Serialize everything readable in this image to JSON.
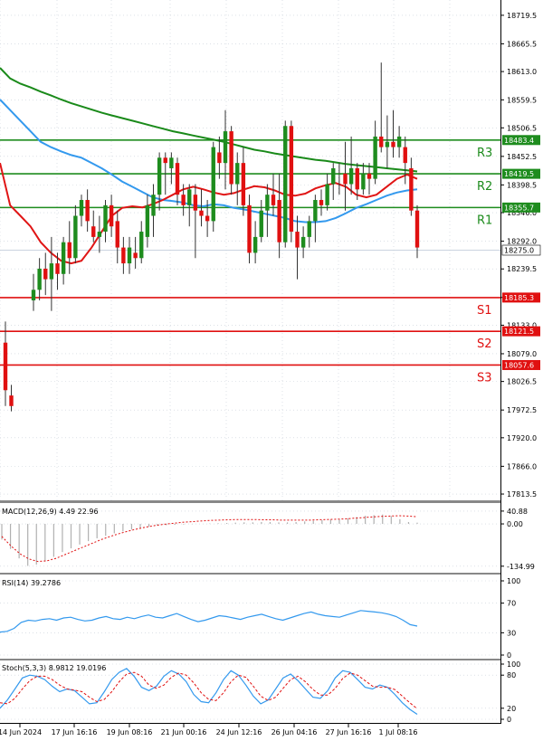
{
  "chart_data": {
    "type": "candlestick",
    "main": {
      "price_ticks": [
        "18719.5",
        "18665.5",
        "18613.0",
        "18559.5",
        "18506.5",
        "18452.5",
        "18398.5",
        "18346.0",
        "18292.0",
        "18239.5",
        "18185.5",
        "18133.0",
        "18079.0",
        "18026.5",
        "17972.5",
        "17920.0",
        "17866.0",
        "17813.5"
      ],
      "ylim": [
        17805,
        18745
      ],
      "last_price": "18275.0",
      "levels": [
        {
          "name": "R3",
          "label": "18483.4",
          "value": 18483.4,
          "color": "#1e8c1e"
        },
        {
          "name": "R2",
          "label": "18419.5",
          "value": 18419.5,
          "color": "#1e8c1e"
        },
        {
          "name": "R1",
          "label": "18355.7",
          "value": 18355.7,
          "color": "#1e8c1e"
        },
        {
          "name": "S1",
          "label": "18185.3",
          "value": 18185.3,
          "color": "#e01010"
        },
        {
          "name": "S2",
          "label": "18121.5",
          "value": 18121.5,
          "color": "#e01010"
        },
        {
          "name": "S3",
          "label": "18057.6",
          "value": 18057.6,
          "color": "#e01010"
        }
      ],
      "candles": [
        [
          18100,
          18140,
          17980,
          18010
        ],
        [
          18000,
          18020,
          17970,
          17980
        ],
        [
          18180,
          18230,
          18160,
          18200
        ],
        [
          18200,
          18260,
          18180,
          18240
        ],
        [
          18240,
          18270,
          18190,
          18220
        ],
        [
          18220,
          18300,
          18160,
          18250
        ],
        [
          18250,
          18270,
          18200,
          18230
        ],
        [
          18230,
          18300,
          18210,
          18290
        ],
        [
          18290,
          18330,
          18230,
          18260
        ],
        [
          18260,
          18360,
          18250,
          18340
        ],
        [
          18340,
          18380,
          18320,
          18370
        ],
        [
          18370,
          18390,
          18310,
          18330
        ],
        [
          18320,
          18350,
          18290,
          18300
        ],
        [
          18300,
          18340,
          18270,
          18310
        ],
        [
          18310,
          18370,
          18290,
          18360
        ],
        [
          18360,
          18380,
          18300,
          18320
        ],
        [
          18330,
          18350,
          18250,
          18280
        ],
        [
          18280,
          18300,
          18230,
          18250
        ],
        [
          18250,
          18300,
          18230,
          18280
        ],
        [
          18270,
          18300,
          18240,
          18260
        ],
        [
          18260,
          18330,
          18250,
          18310
        ],
        [
          18300,
          18380,
          18280,
          18360
        ],
        [
          18340,
          18400,
          18300,
          18380
        ],
        [
          18380,
          18460,
          18350,
          18450
        ],
        [
          18450,
          18460,
          18380,
          18440
        ],
        [
          18430,
          18460,
          18400,
          18450
        ],
        [
          18440,
          18450,
          18360,
          18380
        ],
        [
          18380,
          18400,
          18340,
          18360
        ],
        [
          18360,
          18400,
          18320,
          18390
        ],
        [
          18380,
          18400,
          18260,
          18350
        ],
        [
          18350,
          18390,
          18320,
          18340
        ],
        [
          18340,
          18370,
          18300,
          18330
        ],
        [
          18330,
          18480,
          18310,
          18470
        ],
        [
          18460,
          18490,
          18410,
          18440
        ],
        [
          18440,
          18540,
          18390,
          18500
        ],
        [
          18500,
          18510,
          18380,
          18400
        ],
        [
          18400,
          18460,
          18360,
          18440
        ],
        [
          18440,
          18470,
          18340,
          18360
        ],
        [
          18360,
          18380,
          18250,
          18270
        ],
        [
          18270,
          18330,
          18250,
          18300
        ],
        [
          18300,
          18370,
          18290,
          18350
        ],
        [
          18350,
          18400,
          18300,
          18380
        ],
        [
          18380,
          18420,
          18340,
          18360
        ],
        [
          18370,
          18420,
          18260,
          18290
        ],
        [
          18290,
          18520,
          18280,
          18510
        ],
        [
          18510,
          18520,
          18290,
          18310
        ],
        [
          18310,
          18340,
          18220,
          18280
        ],
        [
          18280,
          18320,
          18260,
          18300
        ],
        [
          18300,
          18340,
          18280,
          18330
        ],
        [
          18330,
          18380,
          18290,
          18370
        ],
        [
          18370,
          18390,
          18340,
          18360
        ],
        [
          18360,
          18420,
          18350,
          18400
        ],
        [
          18400,
          18440,
          18370,
          18430
        ],
        [
          18420,
          18440,
          18380,
          18420
        ],
        [
          18420,
          18480,
          18350,
          18400
        ],
        [
          18400,
          18490,
          18380,
          18430
        ],
        [
          18430,
          18440,
          18370,
          18390
        ],
        [
          18390,
          18440,
          18380,
          18420
        ],
        [
          18420,
          18440,
          18380,
          18410
        ],
        [
          18410,
          18520,
          18400,
          18490
        ],
        [
          18490,
          18630,
          18460,
          18470
        ],
        [
          18470,
          18530,
          18430,
          18480
        ],
        [
          18480,
          18540,
          18450,
          18470
        ],
        [
          18470,
          18510,
          18450,
          18490
        ],
        [
          18470,
          18490,
          18400,
          18440
        ],
        [
          18430,
          18450,
          18340,
          18350
        ],
        [
          18350,
          18360,
          18260,
          18280
        ]
      ],
      "ma_green": [
        18620,
        18600,
        18590,
        18583,
        18575,
        18568,
        18560,
        18553,
        18547,
        18541,
        18535,
        18530,
        18525,
        18520,
        18515,
        18510,
        18505,
        18500,
        18496,
        18492,
        18488,
        18484,
        18480,
        18475,
        18470,
        18465,
        18462,
        18458,
        18455,
        18452,
        18449,
        18446,
        18444,
        18441,
        18438,
        18436,
        18434,
        18432,
        18430,
        18428,
        18426,
        18424
      ],
      "ma_blue": [
        18560,
        18540,
        18520,
        18500,
        18480,
        18470,
        18462,
        18455,
        18450,
        18440,
        18430,
        18418,
        18405,
        18395,
        18385,
        18375,
        18370,
        18368,
        18365,
        18360,
        18358,
        18362,
        18360,
        18355,
        18352,
        18348,
        18344,
        18340,
        18336,
        18330,
        18328,
        18328,
        18330,
        18336,
        18345,
        18355,
        18362,
        18370,
        18378,
        18384,
        18388,
        18390
      ],
      "ma_red": [
        18440,
        18360,
        18340,
        18320,
        18290,
        18270,
        18255,
        18250,
        18255,
        18280,
        18310,
        18340,
        18355,
        18358,
        18356,
        18362,
        18370,
        18380,
        18390,
        18395,
        18390,
        18384,
        18380,
        18383,
        18390,
        18396,
        18394,
        18388,
        18380,
        18378,
        18382,
        18392,
        18398,
        18402,
        18395,
        18380,
        18375,
        18380,
        18395,
        18410,
        18418,
        18410
      ]
    },
    "macd": {
      "label": "MACD(12,26,9) 4.49 22.96",
      "ticks": [
        "40.88",
        "0.00",
        "-134.99"
      ],
      "ylim": [
        -150,
        55
      ],
      "hist": [
        -50,
        -80,
        -110,
        -134,
        -130,
        -120,
        -105,
        -90,
        -78,
        -66,
        -55,
        -46,
        -38,
        -30,
        -24,
        -18,
        -13,
        -9,
        -6,
        -4,
        -3,
        -2,
        -1,
        0,
        1,
        2,
        3,
        4,
        5,
        5,
        6,
        6,
        5,
        5,
        6,
        8,
        10,
        12,
        14,
        16,
        18,
        22,
        26,
        28,
        30,
        25,
        15,
        6,
        4
      ],
      "signal": [
        -40,
        -70,
        -95,
        -112,
        -120,
        -118,
        -110,
        -98,
        -86,
        -74,
        -62,
        -50,
        -40,
        -31,
        -23,
        -16,
        -10,
        -5,
        -1,
        2,
        5,
        7,
        9,
        11,
        12,
        13,
        14,
        14,
        14,
        13,
        13,
        12,
        12,
        12,
        12,
        13,
        14,
        15,
        16,
        18,
        20,
        22,
        24,
        25,
        26,
        25,
        23
      ]
    },
    "rsi": {
      "label": "RSI(14) 39.2786",
      "ticks": [
        "100",
        "70",
        "30",
        "0"
      ],
      "ylim": [
        0,
        100
      ],
      "values": [
        31,
        32,
        36,
        44,
        47,
        46,
        48,
        49,
        47,
        50,
        51,
        48,
        46,
        47,
        50,
        52,
        49,
        48,
        51,
        49,
        52,
        54,
        51,
        50,
        53,
        56,
        52,
        48,
        45,
        47,
        50,
        53,
        52,
        50,
        48,
        51,
        53,
        55,
        52,
        49,
        47,
        50,
        53,
        56,
        58,
        55,
        53,
        52,
        51,
        54,
        57,
        60,
        59,
        58,
        57,
        55,
        52,
        47,
        41,
        39
      ]
    },
    "stoch": {
      "label": "Stoch(5,3,3) 8.9812 19.0196",
      "ticks": [
        "100",
        "80",
        "20",
        "0"
      ],
      "ylim": [
        0,
        100
      ],
      "k": [
        20,
        35,
        55,
        75,
        80,
        78,
        72,
        60,
        50,
        55,
        52,
        40,
        28,
        30,
        50,
        72,
        85,
        92,
        78,
        58,
        52,
        60,
        78,
        88,
        82,
        68,
        45,
        32,
        30,
        48,
        72,
        88,
        80,
        62,
        42,
        28,
        35,
        55,
        75,
        82,
        70,
        55,
        40,
        38,
        52,
        75,
        88,
        85,
        72,
        58,
        55,
        62,
        58,
        45,
        30,
        18,
        9
      ],
      "d": [
        30,
        28,
        38,
        55,
        70,
        78,
        78,
        72,
        62,
        55,
        53,
        50,
        40,
        32,
        36,
        50,
        68,
        82,
        85,
        78,
        62,
        56,
        62,
        76,
        84,
        80,
        66,
        48,
        36,
        34,
        48,
        68,
        80,
        76,
        60,
        42,
        34,
        40,
        56,
        72,
        78,
        68,
        54,
        44,
        44,
        56,
        74,
        84,
        80,
        70,
        60,
        58,
        58,
        54,
        42,
        30,
        19
      ]
    },
    "x_labels": [
      "14 Jun 2024",
      "17 Jun 16:16",
      "19 Jun 08:16",
      "21 Jun 00:16",
      "24 Jun 12:16",
      "26 Jun 04:16",
      "27 Jun 16:16",
      "1 Jul 08:16"
    ]
  },
  "colors": {
    "bull": "#1e8c1e",
    "bear": "#e01010",
    "ma_green": "#1a8a1a",
    "ma_blue": "#3399ee",
    "ma_red": "#e01515",
    "grid": "#c8cfd8",
    "axis": "#000000"
  }
}
